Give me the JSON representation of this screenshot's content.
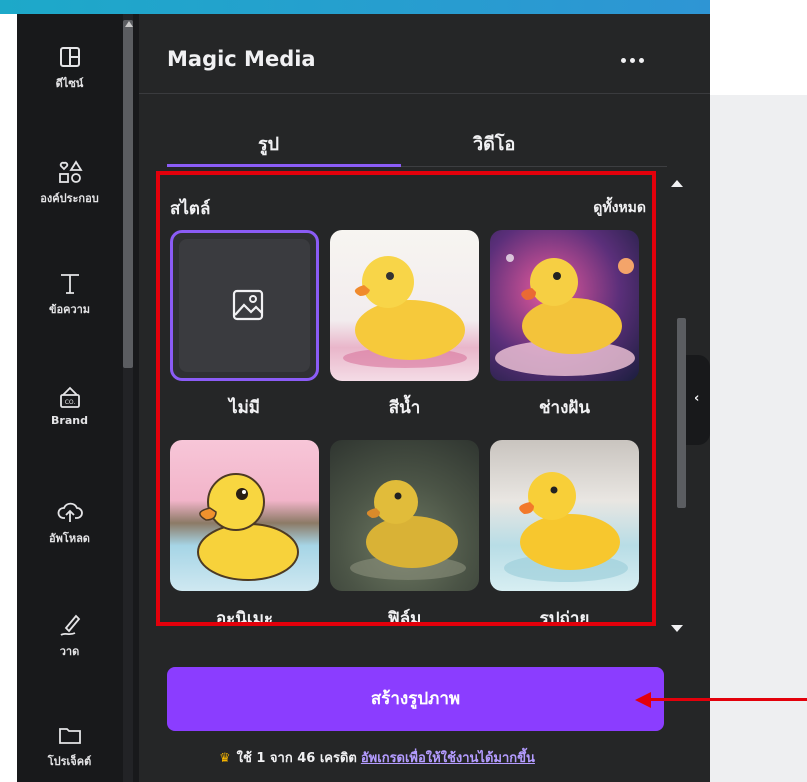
{
  "sidebar": {
    "items": [
      {
        "label": "ดีไซน์",
        "icon": "layout-icon"
      },
      {
        "label": "องค์ประกอบ",
        "icon": "shapes-icon"
      },
      {
        "label": "ข้อความ",
        "icon": "text-icon"
      },
      {
        "label": "Brand",
        "icon": "brand-kit-icon"
      },
      {
        "label": "อัพโหลด",
        "icon": "upload-cloud-icon"
      },
      {
        "label": "วาด",
        "icon": "draw-pen-icon"
      },
      {
        "label": "โปรเจ็คต์",
        "icon": "folder-icon"
      }
    ]
  },
  "panel": {
    "title": "Magic Media",
    "more_label": "•••",
    "tabs": [
      {
        "label": "รูป",
        "active": true
      },
      {
        "label": "วิดีโอ",
        "active": false
      }
    ],
    "styles": {
      "title": "สไตล์",
      "see_all": "ดูทั้งหมด",
      "items": [
        {
          "label": "ไม่มี",
          "selected": true,
          "icon": "image-placeholder-icon"
        },
        {
          "label": "สีน้ำ",
          "selected": false
        },
        {
          "label": "ช่างฝัน",
          "selected": false
        },
        {
          "label": "อะนิเมะ",
          "selected": false
        },
        {
          "label": "ฟิล์ม",
          "selected": false
        },
        {
          "label": "รูปถ่าย",
          "selected": false
        }
      ]
    },
    "create_button": "สร้างรูปภาพ",
    "credits": {
      "text": "ใช้ 1 จาก 46 เครดิต",
      "upgrade_link": "อัพเกรดเพื่อให้ใช้งานได้มากขึ้น"
    }
  },
  "colors": {
    "accent": "#8b3dff",
    "selection": "#8b5cf6",
    "highlight": "#e3000b",
    "panel_bg": "#252627",
    "rail_bg": "#18191b"
  }
}
